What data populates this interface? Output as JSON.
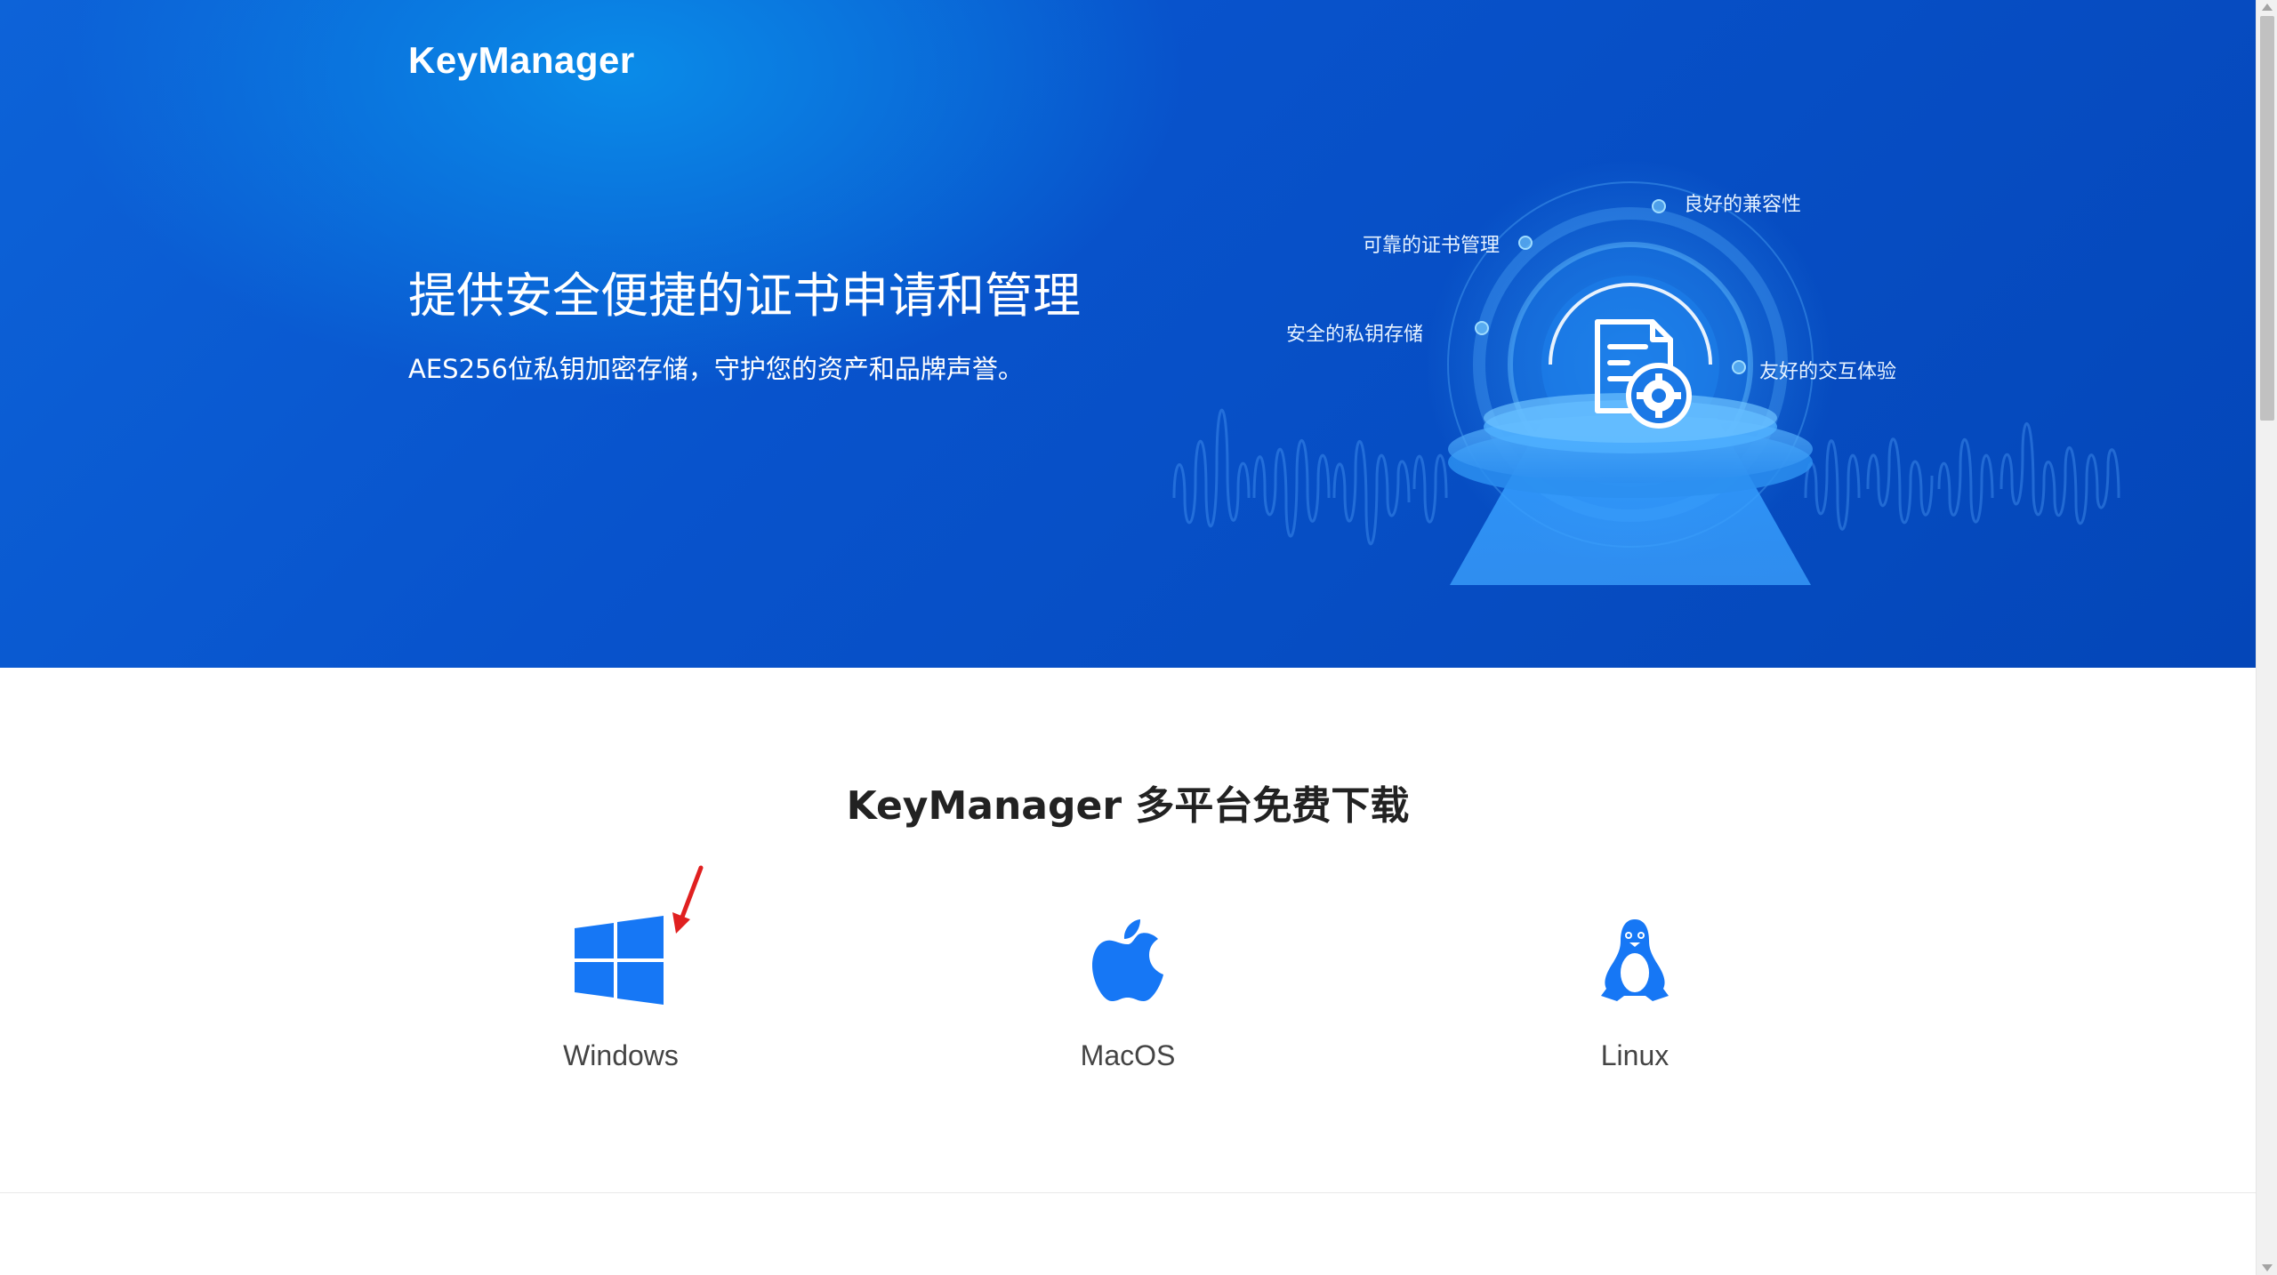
{
  "header": {
    "logo": "KeyManager"
  },
  "hero": {
    "headline": "提供安全便捷的证书申请和管理",
    "subline": "AES256位私钥加密存储，守护您的资产和品牌声誉。",
    "features": [
      {
        "label": "良好的兼容性"
      },
      {
        "label": "可靠的证书管理"
      },
      {
        "label": "安全的私钥存储"
      },
      {
        "label": "友好的交互体验"
      }
    ]
  },
  "downloads": {
    "title": "KeyManager 多平台免费下载",
    "platforms": [
      {
        "label": "Windows",
        "icon": "windows-icon"
      },
      {
        "label": "MacOS",
        "icon": "apple-icon"
      },
      {
        "label": "Linux",
        "icon": "linux-penguin-icon"
      }
    ]
  },
  "colors": {
    "hero_bg": "#0853cc",
    "icon_blue": "#1677f5",
    "annotation_arrow": "#e02020"
  }
}
